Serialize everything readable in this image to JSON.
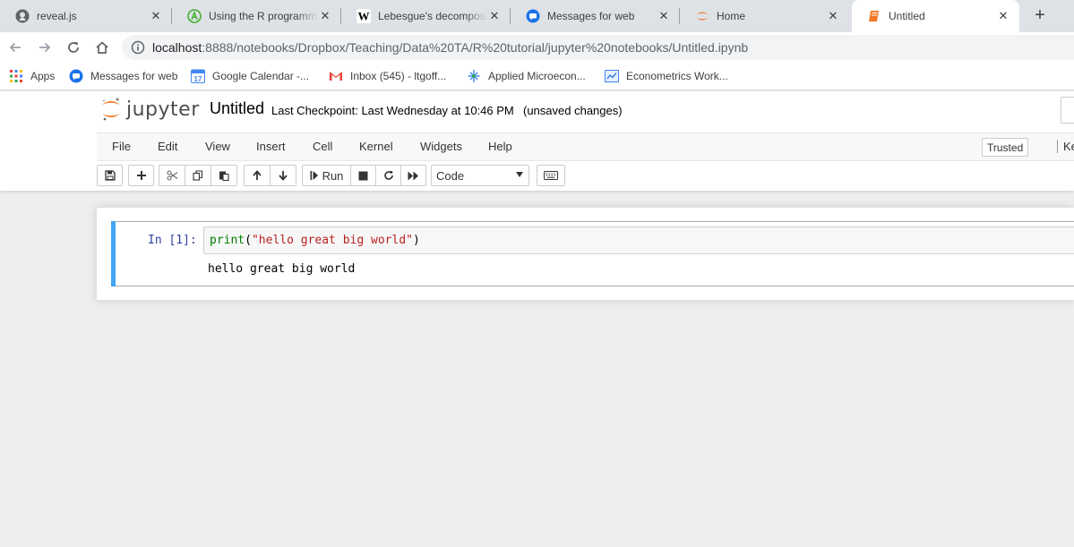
{
  "browser": {
    "tabs": [
      {
        "title": "reveal.js",
        "icon": "github-icon"
      },
      {
        "title": "Using the R programming language in Jupyter",
        "icon": "anaconda-icon"
      },
      {
        "title": "Lebesgue's decomposition theorem",
        "icon": "wikipedia-icon"
      },
      {
        "title": "Messages for web",
        "icon": "messages-icon"
      },
      {
        "title": "Home",
        "icon": "jupyter-icon"
      },
      {
        "title": "Untitled",
        "icon": "notebook-icon"
      }
    ],
    "active_tab": 5,
    "close_glyph": "✕",
    "new_tab_glyph": "+",
    "url_host": "localhost",
    "url_rest": ":8888/notebooks/Dropbox/Teaching/Data%20TA/R%20tutorial/jupyter%20notebooks/Untitled.ipynb",
    "bookmarks": [
      {
        "label": "Apps",
        "icon": "apps-grid-icon"
      },
      {
        "label": "Messages for web",
        "icon": "messages-icon"
      },
      {
        "label": "Google Calendar -...",
        "icon": "calendar-icon",
        "icon_text": "17"
      },
      {
        "label": "Inbox (545) - ltgoff...",
        "icon": "gmail-icon"
      },
      {
        "label": "Applied Microecon...",
        "icon": "bookmark-link-icon"
      },
      {
        "label": "Econometrics Work...",
        "icon": "bookmark-page-icon"
      }
    ]
  },
  "jupyter": {
    "logo_text": "jupyter",
    "notebook_name": "Untitled",
    "checkpoint": "Last Checkpoint: Last Wednesday at 10:46 PM",
    "unsaved": "(unsaved changes)",
    "menu": [
      "File",
      "Edit",
      "View",
      "Insert",
      "Cell",
      "Kernel",
      "Widgets",
      "Help"
    ],
    "trusted": "Trusted",
    "kernel_stub": "Ke",
    "toolbar": {
      "run_label": "Run",
      "cell_type": "Code"
    },
    "cell": {
      "prompt": "In [1]:",
      "code_fn": "print",
      "code_open": "(",
      "code_str": "\"hello great big world\"",
      "code_close": ")",
      "output": "hello great big world"
    }
  },
  "colors": {
    "jupyter_orange": "#f37726",
    "cell_selected_bar": "#42a5f5",
    "prompt_blue": "#303f9f"
  }
}
